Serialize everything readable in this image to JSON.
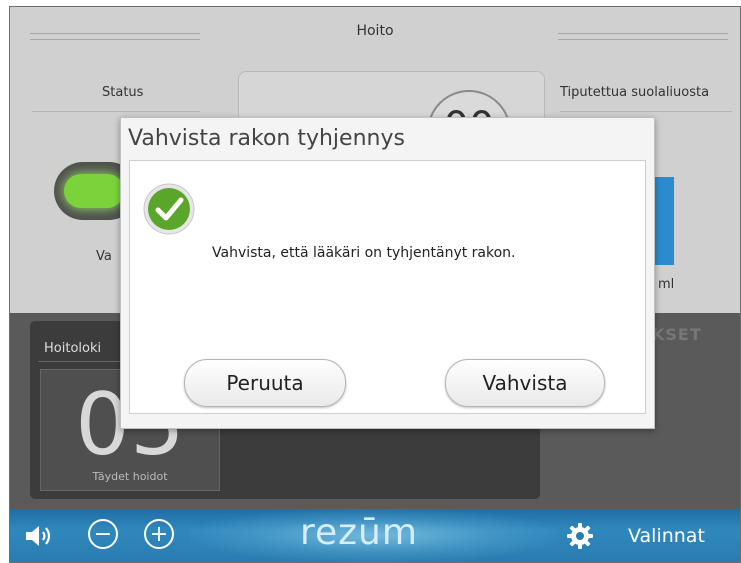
{
  "main": {
    "title": "Hoito",
    "status_header": "Status",
    "status_value_partial": "Va",
    "center_value_partial": "00",
    "saline_header": "Tiputettua suolaliuosta",
    "saline_unit_partial": "ml"
  },
  "log": {
    "title": "Hoitoloki",
    "count_partial": "05",
    "count_label": "Täydet hoidot",
    "background_partial": "UKSET"
  },
  "bottom_bar": {
    "logo": "rezūm",
    "minus_symbol": "−",
    "plus_symbol": "+",
    "options_label": "Valinnat",
    "icons": [
      "speaker-icon",
      "minus-icon",
      "plus-icon",
      "gear-icon"
    ]
  },
  "dialog": {
    "title": "Vahvista rakon tyhjennys",
    "message": "Vahvista, että lääkäri on tyhjentänyt rakon.",
    "cancel_label": "Peruuta",
    "confirm_label": "Vahvista",
    "icon": "check-icon"
  },
  "colors": {
    "status_green": "#7ad33b",
    "saline_blue": "#2c8bcc",
    "check_green": "#5aa62a",
    "bar_blue": "#2a7cb0"
  }
}
